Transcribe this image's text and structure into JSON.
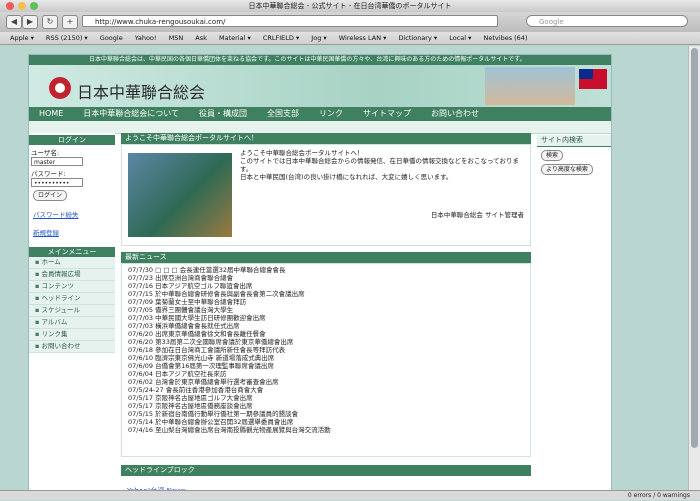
{
  "window": {
    "title": "日本中華聯合総会 - 公式サイト - 在日台湾華僑のポータルサイト"
  },
  "toolbar": {
    "url": "http://www.chuka-rengousoukai.com/",
    "search_placeholder": "Google"
  },
  "bookmarks": [
    "Apple ▾",
    "RSS (2150) ▾",
    "Google",
    "Yahoo!",
    "MSN",
    "Ask",
    "Material ▾",
    "CRLFIELD ▾",
    "Jog ▾",
    "Wireless LAN ▾",
    "Dictionary ▾",
    "Local ▾",
    "Netvibes (64)"
  ],
  "site": {
    "topline": "日本中華聯合総会は、中華民国の各個日華僑団体を束ねる協会です。このサイトは中華民国華僑の方々や、台湾に興味のある方のための情報ポータルサイトです。",
    "logo_text": "日本中華聯合総会",
    "nav": [
      "HOME",
      "日本中華聯合総会について",
      "役員・構成団",
      "全国支部",
      "リンク",
      "サイトマップ",
      "お問い合わせ"
    ]
  },
  "login": {
    "header": "ログイン",
    "user_label": "ユーザ名:",
    "user_value": "master",
    "pass_label": "パスワード:",
    "pass_value": "••••••••••",
    "button": "ログイン",
    "forgot": "パスワード紛失",
    "register": "新規登録"
  },
  "menu": {
    "header": "メインメニュー",
    "items": [
      "ホーム",
      "会員情報広場",
      "コンテンツ",
      "ヘッドライン",
      "スケジュール",
      "アルバム",
      "リンク集",
      "お問い合わせ"
    ]
  },
  "welcome": {
    "header": "ようこそ中華聯合総会ポータルサイトへ！",
    "body": "ようこそ中華聯合総会ポータルサイトへ！\nこのサイトでは日本中華聯合総会からの情報発信、在日華僑の情報交換などをおこなっております。\n日本と中華民国(台湾)の良い掛け橋になれれば、大変に嬉しく思います。",
    "signature": "日本中華聯合総会 サイト管理者"
  },
  "news": {
    "header": "最新ニュース",
    "items": [
      "07/7/30 □ □ □ 会長連任當選32屆中華聯合總會會長",
      "07/7/23 出席亞洲台灣商會聯合總會",
      "07/7/16 日本アジア航空ゴルフ聯誼會出席",
      "07/7/15 於中華聯合總會研修會長與副會長會第二次會議出席",
      "07/7/09 葉菊蘭女士至中華聯合總會拜訪",
      "07/7/05 僑界三團體會議台灣大學生",
      "07/7/03 中華民國大學生訪日研修團歡迎會出席",
      "07/7/03 橫浜華僑總會會長就任式出席",
      "07/6/20 出席東京華僑總會徐文和會長離任餐會",
      "07/6/20 第33屆第二次全國聯席會議於東京華僑總會出席",
      "07/6/18 參加在日台灣商工會議所新任會長等拜訪代表",
      "07/6/10 臨濟宗東京佛光山寺 新道場落成式典出席",
      "07/6/09 台僑會第16屆第一次理監事聯席會議出席",
      "07/6/04 日本アジア航空社長來訪",
      "07/6/02 台灣會於東京華僑總會舉行選考審查會出席",
      "07/5/24-27 會長前往香港參加香港台商會大會",
      "07/5/17 京阪神名古屋地區ゴルフ大會出席",
      "07/5/17 京阪神名古屋地區僑務座談會出席",
      "07/5/15 於新宿台南僑行動舉行僑社第一期參議員的懇談會",
      "07/5/14 於中華聯合總會辦公室召開32屆選舉委員會出席",
      "07/4/16 至山梨台灣總會出席台灣南投縣觀光物產展覽與台灣交流活動"
    ]
  },
  "headlines": {
    "header": "ヘッドラインブロック",
    "link": "Yahoo!台湾 News"
  },
  "site_search": {
    "header": "サイト内検索",
    "button": "検索",
    "advanced": "より高度な検索"
  },
  "status": {
    "text": "0 errors / 0 warnings"
  },
  "colors": {
    "primary_green": "#3f8060",
    "link_blue": "#2257c8",
    "flag_red": "#c8102e"
  }
}
